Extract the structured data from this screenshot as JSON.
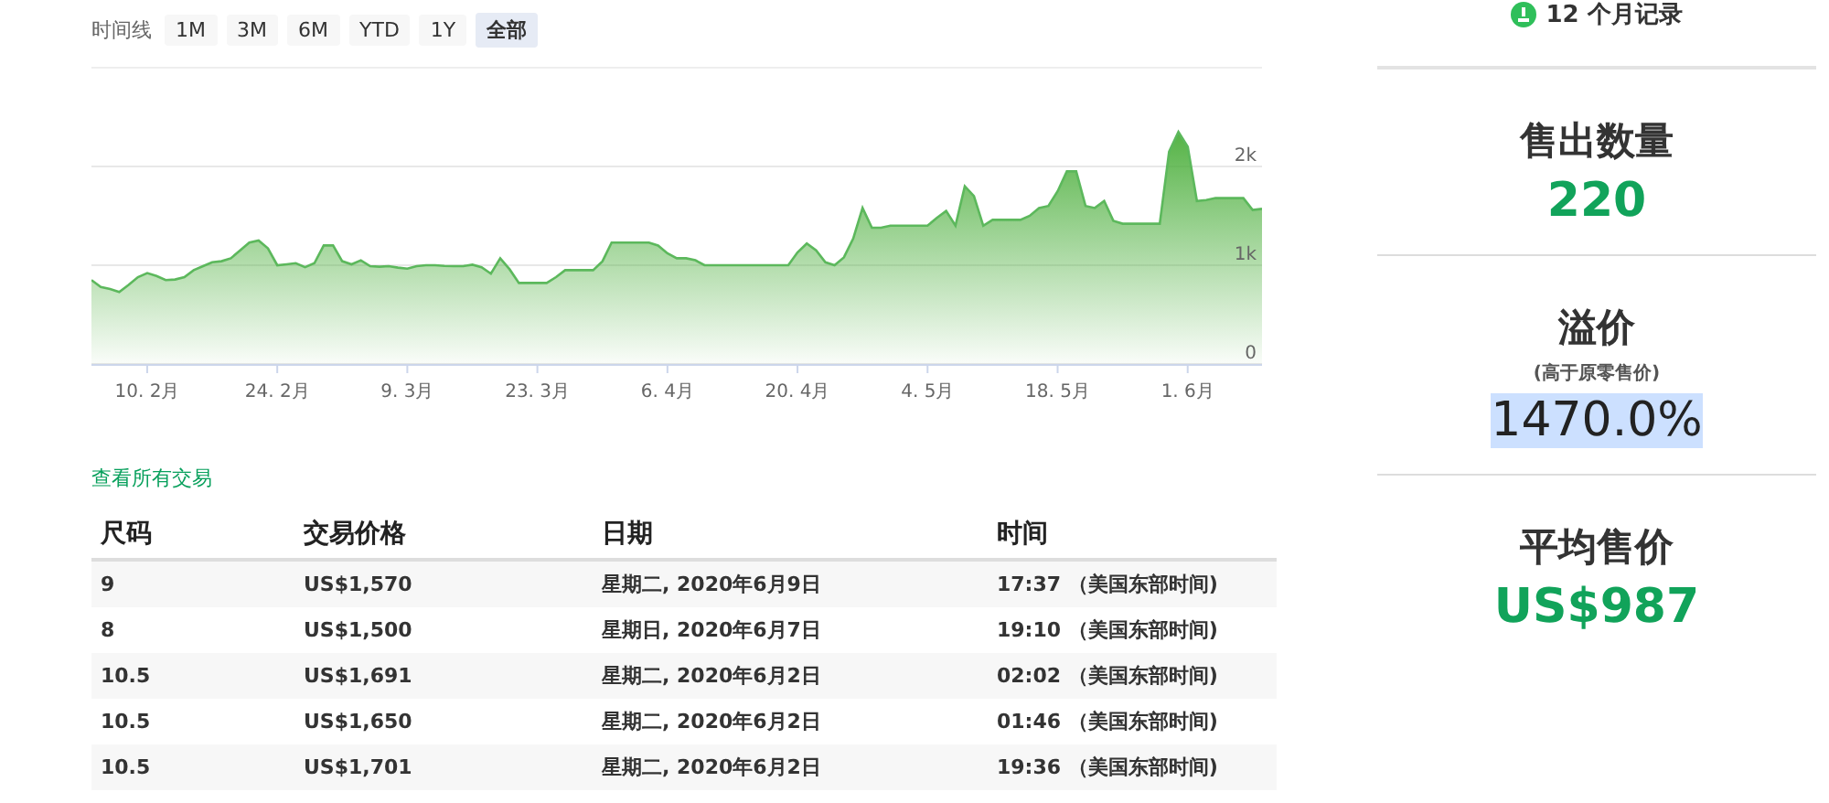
{
  "timeline": {
    "label": "时间线",
    "ranges": [
      {
        "label": "1M",
        "selected": false
      },
      {
        "label": "3M",
        "selected": false
      },
      {
        "label": "6M",
        "selected": false
      },
      {
        "label": "YTD",
        "selected": false
      },
      {
        "label": "1Y",
        "selected": false
      },
      {
        "label": "全部",
        "selected": true
      }
    ]
  },
  "chart_data": {
    "type": "area",
    "categories": [
      null,
      null,
      null,
      null,
      null,
      null,
      "10. 2月",
      null,
      null,
      null,
      null,
      null,
      null,
      null,
      null,
      null,
      null,
      null,
      null,
      null,
      "24. 2月",
      null,
      null,
      null,
      null,
      null,
      null,
      null,
      null,
      null,
      null,
      null,
      null,
      null,
      "9. 3月",
      null,
      null,
      null,
      null,
      null,
      null,
      null,
      null,
      null,
      null,
      null,
      null,
      null,
      "23. 3月",
      null,
      null,
      null,
      null,
      null,
      null,
      null,
      null,
      null,
      null,
      null,
      null,
      null,
      "6. 4月",
      null,
      null,
      null,
      null,
      null,
      null,
      null,
      null,
      null,
      null,
      null,
      null,
      null,
      "20. 4月",
      null,
      null,
      null,
      null,
      null,
      null,
      null,
      null,
      null,
      null,
      null,
      null,
      null,
      "4. 5月",
      null,
      null,
      null,
      null,
      null,
      null,
      null,
      null,
      null,
      null,
      null,
      null,
      null,
      "18. 5月",
      null,
      null,
      null,
      null,
      null,
      null,
      null,
      null,
      null,
      null,
      null,
      null,
      null,
      "1. 6月",
      null,
      null,
      null,
      null,
      null,
      null,
      null,
      null
    ],
    "series": [
      {
        "color": "#5cb85c",
        "values": [
          850,
          780,
          760,
          730,
          800,
          880,
          920,
          890,
          850,
          855,
          880,
          950,
          990,
          1030,
          1040,
          1070,
          1150,
          1230,
          1250,
          1170,
          1000,
          1010,
          1020,
          980,
          1020,
          1200,
          1200,
          1040,
          1010,
          1050,
          990,
          985,
          990,
          975,
          965,
          990,
          1000,
          1000,
          992,
          990,
          990,
          1005,
          980,
          915,
          1070,
          960,
          820,
          820,
          820,
          820,
          880,
          950,
          950,
          950,
          950,
          1040,
          1230,
          1230,
          1230,
          1230,
          1230,
          1200,
          1120,
          1070,
          1070,
          1050,
          1000,
          1000,
          1000,
          1000,
          1000,
          1000,
          1000,
          1000,
          1000,
          1000,
          1130,
          1220,
          1150,
          1030,
          1000,
          1080,
          1270,
          1580,
          1380,
          1380,
          1400,
          1400,
          1400,
          1400,
          1400,
          1480,
          1550,
          1400,
          1800,
          1700,
          1400,
          1460,
          1460,
          1460,
          1460,
          1500,
          1580,
          1600,
          1750,
          1950,
          1950,
          1600,
          1580,
          1650,
          1450,
          1420,
          1420,
          1420,
          1420,
          1420,
          2150,
          2350,
          2200,
          1650,
          1660,
          1680,
          1680,
          1680,
          1680,
          1560,
          1570
        ]
      }
    ],
    "ylim": [
      0,
      3000
    ],
    "yticks": [
      {
        "value": 0,
        "label": "0"
      },
      {
        "value": 1000,
        "label": "1k"
      },
      {
        "value": 2000,
        "label": "2k"
      }
    ]
  },
  "view_all_link": "查看所有交易",
  "table": {
    "columns": [
      "尺码",
      "交易价格",
      "日期",
      "时间"
    ],
    "rows": [
      [
        "9",
        "US$1,570",
        "星期二, 2020年6月9日",
        "17:37 （美国东部时间)"
      ],
      [
        "8",
        "US$1,500",
        "星期日, 2020年6月7日",
        "19:10 （美国东部时间)"
      ],
      [
        "10.5",
        "US$1,691",
        "星期二, 2020年6月2日",
        "02:02 （美国东部时间)"
      ],
      [
        "10.5",
        "US$1,650",
        "星期二, 2020年6月2日",
        "01:46 （美国东部时间)"
      ],
      [
        "10.5",
        "US$1,701",
        "星期二, 2020年6月2日",
        "19:36 （美国东部时间)"
      ]
    ]
  },
  "record": "12 个月记录",
  "stats": [
    {
      "kind": "count",
      "title": "售出数量",
      "value": "220",
      "highlighted": false
    },
    {
      "kind": "percent",
      "title": "溢价",
      "subtitle": "(高于原零售价)",
      "value": "1470.0%",
      "highlighted": true
    },
    {
      "kind": "price",
      "title": "平均售价",
      "value": "US$987",
      "highlighted": false
    }
  ]
}
